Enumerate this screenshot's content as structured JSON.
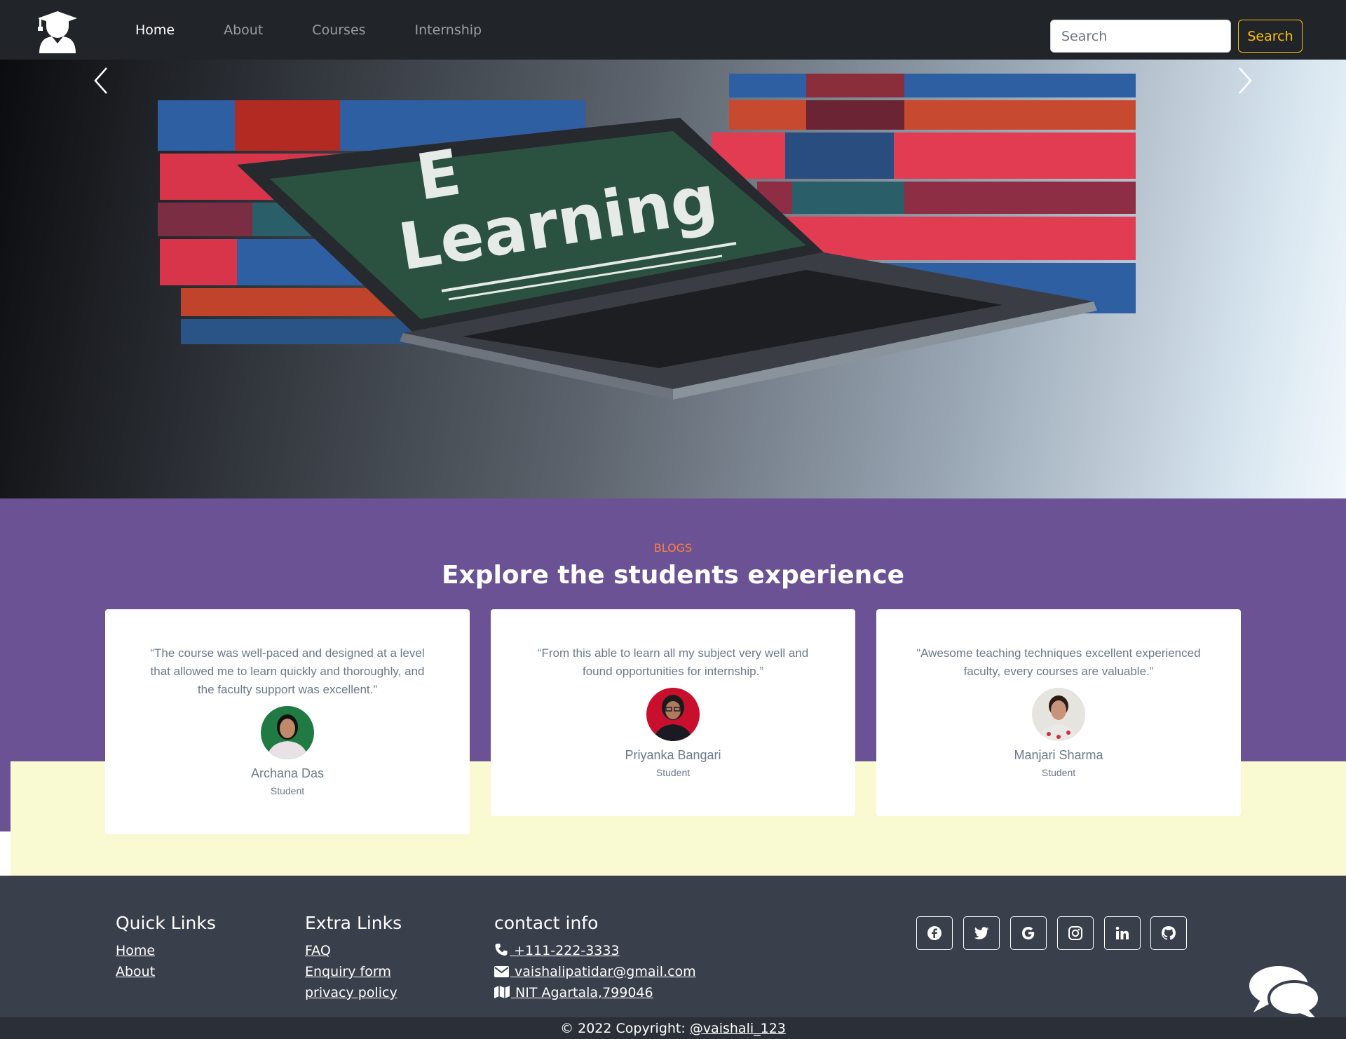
{
  "nav": {
    "links": [
      {
        "label": "Home",
        "active": true
      },
      {
        "label": "About",
        "active": false
      },
      {
        "label": "Courses",
        "active": false
      },
      {
        "label": "Internship",
        "active": false
      }
    ],
    "search_placeholder": "Search",
    "search_button": "Search"
  },
  "hero": {
    "image_text_line1": "E",
    "image_text_line2": "Learning"
  },
  "blogs": {
    "label": "BLOGS",
    "title": "Explore the students experience",
    "cards": [
      {
        "quote": "“The course was well-paced and designed at a level that allowed me to learn quickly and thoroughly, and the faculty support was excellent.”",
        "name": "Archana Das",
        "role": "Student"
      },
      {
        "quote": "“From this able to learn all my subject very well and found opportunities for internship.”",
        "name": "Priyanka Bangari",
        "role": "Student"
      },
      {
        "quote": "“Awesome teaching techniques excellent experienced faculty, every courses are valuable.”",
        "name": "Manjari Sharma",
        "role": "Student"
      }
    ]
  },
  "footer": {
    "quick_links": {
      "title": "Quick Links",
      "items": [
        "Home",
        "About"
      ]
    },
    "extra_links": {
      "title": "Extra Links",
      "items": [
        "FAQ",
        "Enquiry form",
        "privacy policy"
      ]
    },
    "contact": {
      "title": "contact info",
      "phone": " +111-222-3333",
      "email": " vaishalipatidar@gmail.com",
      "address": " NIT Agartala,799046"
    },
    "social_icons": [
      "facebook-icon",
      "twitter-icon",
      "google-icon",
      "instagram-icon",
      "linkedin-icon",
      "github-icon"
    ],
    "copyright_prefix": "© 2022 Copyright: ",
    "copyright_handle": "@vaishali_123"
  },
  "colors": {
    "navbar": "#212529",
    "accent_yellow": "#ffc107",
    "blogs_bg": "#6b5294",
    "blogs_label": "#ff7f3f",
    "cream": "#f9f9d2",
    "footer": "#3a3f4c"
  }
}
